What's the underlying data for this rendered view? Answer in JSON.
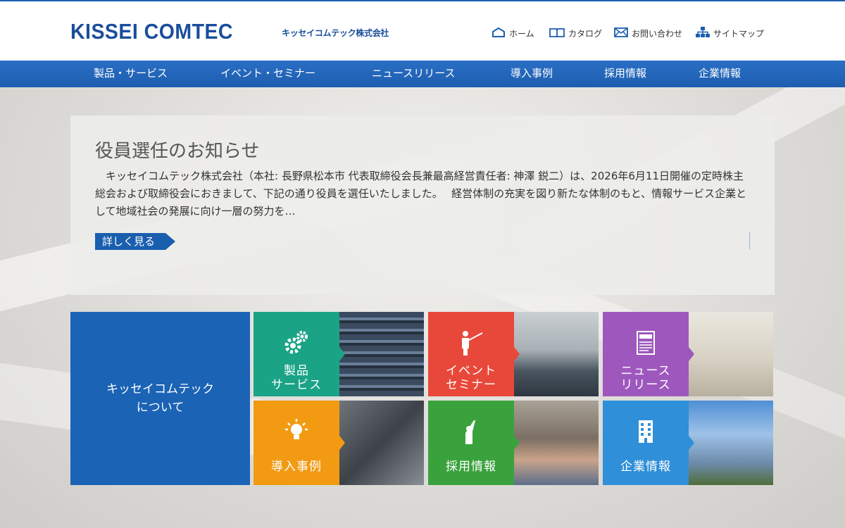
{
  "header": {
    "logo": "KISSEI COMTEC",
    "logo_sub": "キッセイコムテック株式会社",
    "links": [
      {
        "label": "ホーム",
        "icon": "home-icon"
      },
      {
        "label": "カタログ",
        "icon": "book-icon"
      },
      {
        "label": "お問い合わせ",
        "icon": "mail-icon"
      },
      {
        "label": "サイトマップ",
        "icon": "sitemap-icon"
      }
    ]
  },
  "nav": [
    "製品・サービス",
    "イベント・セミナー",
    "ニュースリリース",
    "導入事例",
    "採用情報",
    "企業情報"
  ],
  "news": {
    "title": "役員選任のお知らせ",
    "body": "キッセイコムテック株式会社（本社: 長野県松本市 代表取締役会長兼最高経営責任者: 神澤 鋭二）は、2026年6月11日開催の定時株主総会および取締役会におきまして、下記の通り役員を選任いたしました。　 経営体制の充実を図り新たな体制のもと、情報サービス企業として地域社会の発展に向け一層の努力を…",
    "more": "詳しく見る"
  },
  "about": {
    "line1": "キッセイコムテック",
    "line2": "について"
  },
  "tiles": [
    {
      "line1": "製品",
      "line2": "サービス",
      "icon": "gears-icon",
      "color": "#1aa385"
    },
    {
      "line1": "イベント",
      "line2": "セミナー",
      "icon": "presenter-icon",
      "color": "#e8483a"
    },
    {
      "line1": "ニュース",
      "line2": "リリース",
      "icon": "newspaper-icon",
      "color": "#9e58bd"
    },
    {
      "line1": "導入事例",
      "line2": "",
      "icon": "lightbulb-icon",
      "color": "#f19a12"
    },
    {
      "line1": "採用情報",
      "line2": "",
      "icon": "hand-raise-icon",
      "color": "#3aa23d"
    },
    {
      "line1": "企業情報",
      "line2": "",
      "icon": "building-icon",
      "color": "#2f8fd8"
    }
  ],
  "colors": {
    "brand": "#1a4e9c",
    "nav": "#1d5db0",
    "about_tile": "#1b63b5",
    "more_button": "#1a5fae"
  }
}
